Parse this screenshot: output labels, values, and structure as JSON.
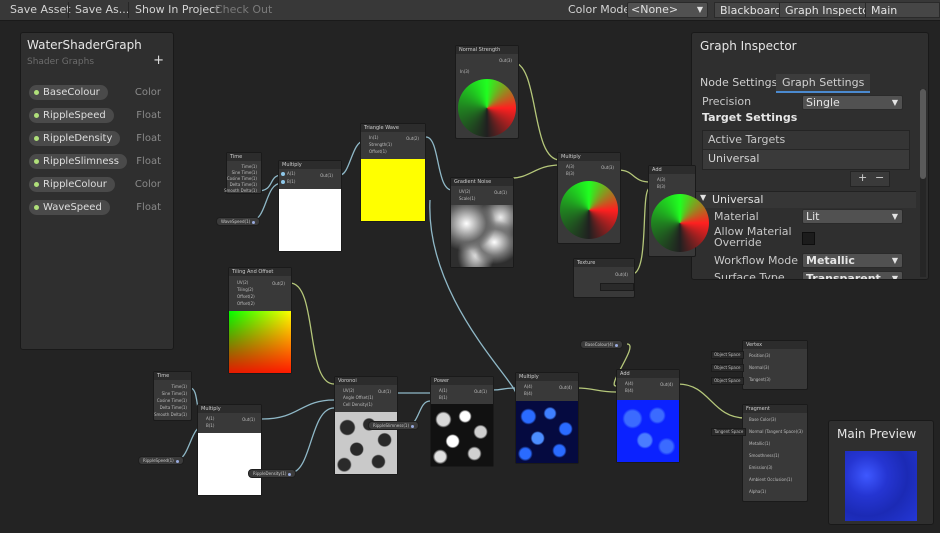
{
  "toolbar": {
    "save_asset": "Save Asset",
    "save_as": "Save As...",
    "show_in_project": "Show In Project",
    "check_out": "Check Out",
    "color_mode_label": "Color Mode",
    "color_mode_value": "<None>",
    "blackboard": "Blackboard",
    "graph_inspector": "Graph Inspector",
    "main_preview": "Main Preview"
  },
  "blackboard": {
    "title": "WaterShaderGraph",
    "subtitle": "Shader Graphs",
    "add": "+",
    "properties": [
      {
        "name": "BaseColour",
        "type": "Color"
      },
      {
        "name": "RippleSpeed",
        "type": "Float"
      },
      {
        "name": "RippleDensity",
        "type": "Float"
      },
      {
        "name": "RippleSlimness",
        "type": "Float"
      },
      {
        "name": "RippleColour",
        "type": "Color"
      },
      {
        "name": "WaveSpeed",
        "type": "Float"
      }
    ]
  },
  "inspector": {
    "title": "Graph Inspector",
    "tabs": [
      "Node Settings",
      "Graph Settings"
    ],
    "precision_label": "Precision",
    "precision_value": "Single",
    "target_settings": "Target Settings",
    "active_targets": "Active Targets",
    "universal": "Universal",
    "plus": "+",
    "minus": "−",
    "universal_section": "Universal",
    "material_label": "Material",
    "material_value": "Lit",
    "allow_override_1": "Allow Material",
    "allow_override_2": "Override",
    "workflow_label": "Workflow Mode",
    "workflow_value": "Metallic",
    "surface_label": "Surface Type",
    "surface_value": "Transparent"
  },
  "preview": {
    "title": "Main Preview"
  },
  "nodes": {
    "time1": {
      "title": "Time",
      "ports": [
        "Time(1)",
        "Sine Time(1)",
        "Cosine Time(1)",
        "Delta Time(1)",
        "Smooth Delta(1)"
      ]
    },
    "multiply1": {
      "title": "Multiply",
      "in": [
        "A(1)",
        "B(1)"
      ],
      "out": "Out(1)"
    },
    "triangle": {
      "title": "Triangle Wave",
      "in": [
        "In(1)",
        "Strength(1)",
        "Offset(1)"
      ],
      "out": "Out(2)"
    },
    "noise1": {
      "title": "Gradient Noise",
      "in": [
        "UV(2)",
        "Scale(1)"
      ],
      "out": "Out(1)"
    },
    "normal_strength": {
      "title": "Normal Strength",
      "in": [
        "In(3)"
      ],
      "out": "Out(3)"
    },
    "multiply2": {
      "title": "Multiply",
      "in": [
        "A(3)",
        "B(3)"
      ],
      "out": "Out(3)"
    },
    "add1": {
      "title": "Add",
      "in": [
        "A(3)",
        "B(3)"
      ],
      "out": "Out(3)"
    },
    "texture": {
      "title": "Texture",
      "out": "Out(4)"
    },
    "uv_offset": {
      "title": "Tiling And Offset",
      "in": [
        "UV(2)",
        "Tiling(2)",
        "Offset(2)",
        "Offset(2)"
      ],
      "out": "Out(2)"
    },
    "time2": {
      "title": "Time",
      "ports": [
        "Time(1)",
        "Sine Time(1)",
        "Cosine Time(1)",
        "Delta Time(1)",
        "Smooth Delta(1)"
      ]
    },
    "multiply3": {
      "title": "Multiply",
      "in": [
        "A(1)",
        "B(1)"
      ],
      "out": "Out(1)"
    },
    "voronoi": {
      "title": "Voronoi",
      "in": [
        "UV(2)",
        "Angle Offset(1)",
        "Cell Density(1)"
      ],
      "out": "Out(1)"
    },
    "power": {
      "title": "Power",
      "in": [
        "A(1)",
        "B(1)"
      ],
      "out": "Out(1)"
    },
    "multiply4": {
      "title": "Multiply",
      "in": [
        "A(4)",
        "B(4)"
      ],
      "out": "Out(4)"
    },
    "add2": {
      "title": "Add",
      "in": [
        "A(4)",
        "B(4)"
      ],
      "out": "Out(4)"
    },
    "vertex": {
      "title": "Vertex",
      "ports": [
        "Position(3)",
        "Normal(3)",
        "Tangent(3)"
      ],
      "spaces": [
        "Object Space",
        "Object Space",
        "Object Space"
      ]
    },
    "fragment": {
      "title": "Fragment",
      "ports": [
        "Base Color(3)",
        "Normal (Tangent Space)(3)",
        "Metallic(1)",
        "Smoothness(1)",
        "Emission(3)",
        "Ambient Occlusion(1)",
        "Alpha(1)"
      ],
      "tangent_space": "Tangent Space"
    }
  },
  "chips": {
    "wave_speed": "WaveSpeed(1)",
    "ripple_speed": "RippleSpeed(1)",
    "ripple_density": "RippleDensity(1)",
    "ripple_slimness": "RippleSlimness(1)",
    "base_colour": "BaseColour(4)"
  },
  "colors": {
    "canvas": "#232323",
    "panel": "#2f2f2f",
    "wire_float": "#8fb8c7",
    "wire_vector": "#b5c77a",
    "accent_tab": "#4b8ad0",
    "property_dot": "#b0e07a"
  }
}
